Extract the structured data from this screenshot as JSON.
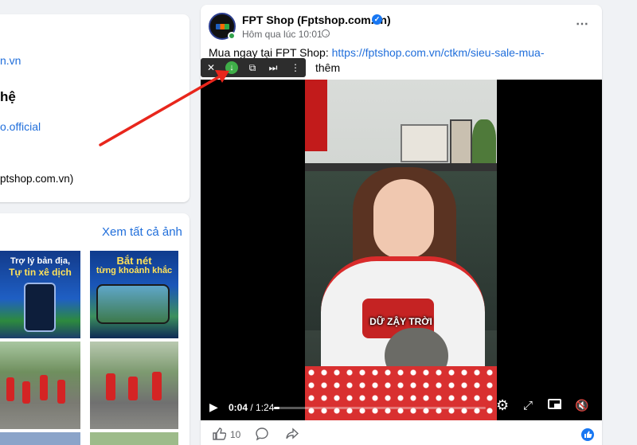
{
  "info": {
    "link1": "n.vn",
    "heading": "hệ",
    "link2": "o.official",
    "text": "ptshop.com.vn)"
  },
  "photos": {
    "see_all": "Xem tất cả ảnh",
    "thumb1": {
      "line1": "Trợ lý bản địa,",
      "line2": "Tự tin xê dịch"
    },
    "thumb2": {
      "line1": "Bắt nét",
      "line2": "từng khoảnh khắc"
    }
  },
  "post": {
    "page_name": "FPT Shop (Fptshop.com.vn)",
    "time": "Hôm qua lúc 10:01 ·",
    "text_prefix": "Mua ngay tại FPT Shop: ",
    "link": "https://fptshop.com.vn/ctkm/sieu-sale-mua-",
    "see_more": "thêm",
    "more_icon": "⋯"
  },
  "video_toolbar": {
    "close": "✕",
    "download": "↓",
    "pip": "⧉",
    "skip": "⏭",
    "menu": "⋮"
  },
  "video": {
    "caption": "DỮ ZẬY TRỜI",
    "time_current": "0:04",
    "time_total": "1:24",
    "time_sep": " / ",
    "progress": 0.026
  },
  "actions": {
    "like_count": "10"
  },
  "colors": {
    "link": "#216fdb",
    "verified": "#1877f2",
    "annotation_arrow": "#e8261c"
  }
}
